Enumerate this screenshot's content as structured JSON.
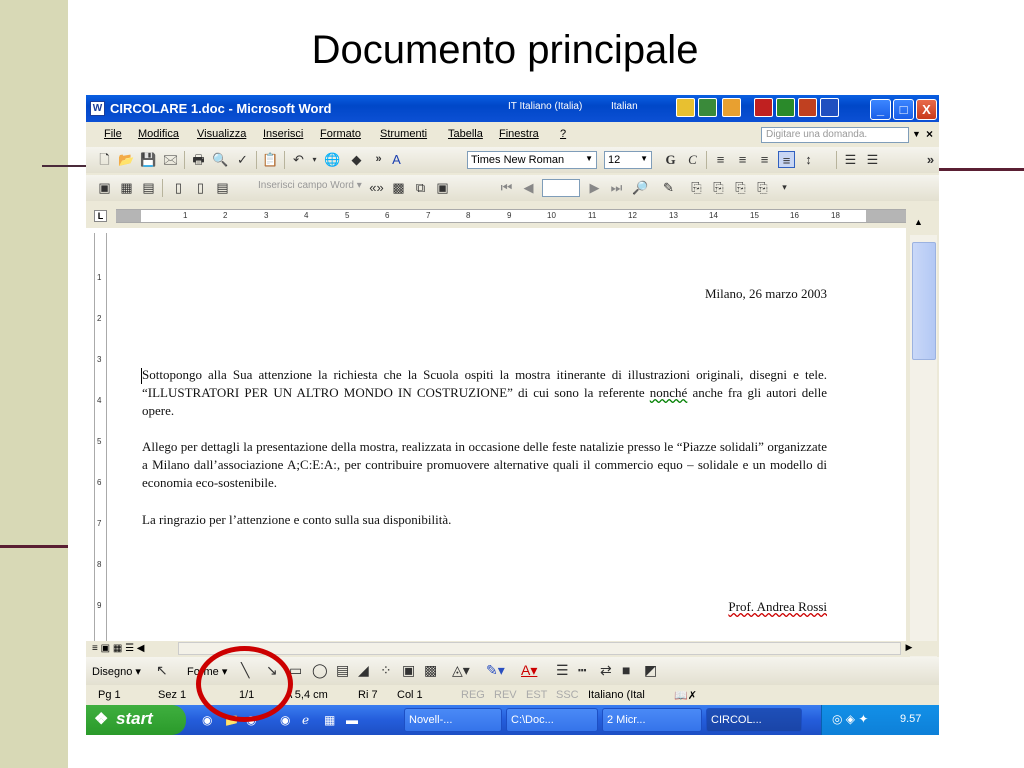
{
  "slide": {
    "title": "Documento principale",
    "colors": {
      "band": "#d8d9b6",
      "accent_line": "#5a1f33",
      "highlight_circle": "#cc0000"
    }
  },
  "window": {
    "title": "CIRCOLARE 1.doc - Microsoft Word",
    "lang_indicator": "IT  Italiano (Italia)",
    "lang_indicator2": "Italian",
    "controls": {
      "minimize": "_",
      "maximize": "□",
      "close": "X"
    }
  },
  "menubar": {
    "items": [
      "File",
      "Modifica",
      "Visualizza",
      "Inserisci",
      "Formato",
      "Strumenti",
      "Tabella",
      "Finestra",
      "?"
    ],
    "ask_placeholder": "Digitare una domanda.",
    "close_doc": "×"
  },
  "formatting": {
    "font": "Times New Roman",
    "size": "12",
    "bold": "G",
    "italic": "C"
  },
  "mailmerge": {
    "field_button": "Inserisci campo Word ▾"
  },
  "ruler": {
    "h_numbers": [
      "1",
      "2",
      "3",
      "4",
      "5",
      "6",
      "7",
      "8",
      "9",
      "10",
      "11",
      "12",
      "13",
      "14",
      "15",
      "16",
      "18"
    ],
    "v_numbers": [
      "1",
      "2",
      "3",
      "4",
      "5",
      "6",
      "7",
      "8",
      "9"
    ]
  },
  "document": {
    "date_line": "Milano, 26 marzo 2003",
    "p1_a": "Sottopongo alla Sua attenzione la richiesta che la Scuola ospiti la mostra itinerante di illustrazioni originali, disegni e tele. “ILLUSTRATORI PER UN ALTRO MONDO IN COSTRUZIONE” di cui sono la referente ",
    "p1_flag": "nonché",
    "p1_b": " anche fra gli autori  delle opere.",
    "p2": "Allego per dettagli la presentazione della mostra, realizzata in occasione delle feste natalizie presso le “Piazze solidali” organizzate a Milano dall’associazione A;C:E:A:, per contribuire promuovere alternative quali il commercio equo – solidale e un modello di economia eco-sostenibile.",
    "p3": "La ringrazio per l’attenzione e conto sulla sua disponibilità.",
    "signature": "Prof.  Andrea Rossi"
  },
  "drawing": {
    "disegno": "Disegno ▾",
    "forme": "Forme ▾"
  },
  "status": {
    "page": "Pg 1",
    "section": "Sez 1",
    "pages": "1/1",
    "at": "A 5,4 cm",
    "line": "Ri 7",
    "col": "Col 1",
    "rec": "REG",
    "rev": "REV",
    "ext": "EST",
    "ovr": "SSC",
    "lang": "Italiano (Ital"
  },
  "taskbar": {
    "start": "start",
    "tasks": [
      "Novell-...",
      "C:\\Doc...",
      "2 Micr...",
      "CIRCOL..."
    ],
    "clock": "9.57"
  }
}
